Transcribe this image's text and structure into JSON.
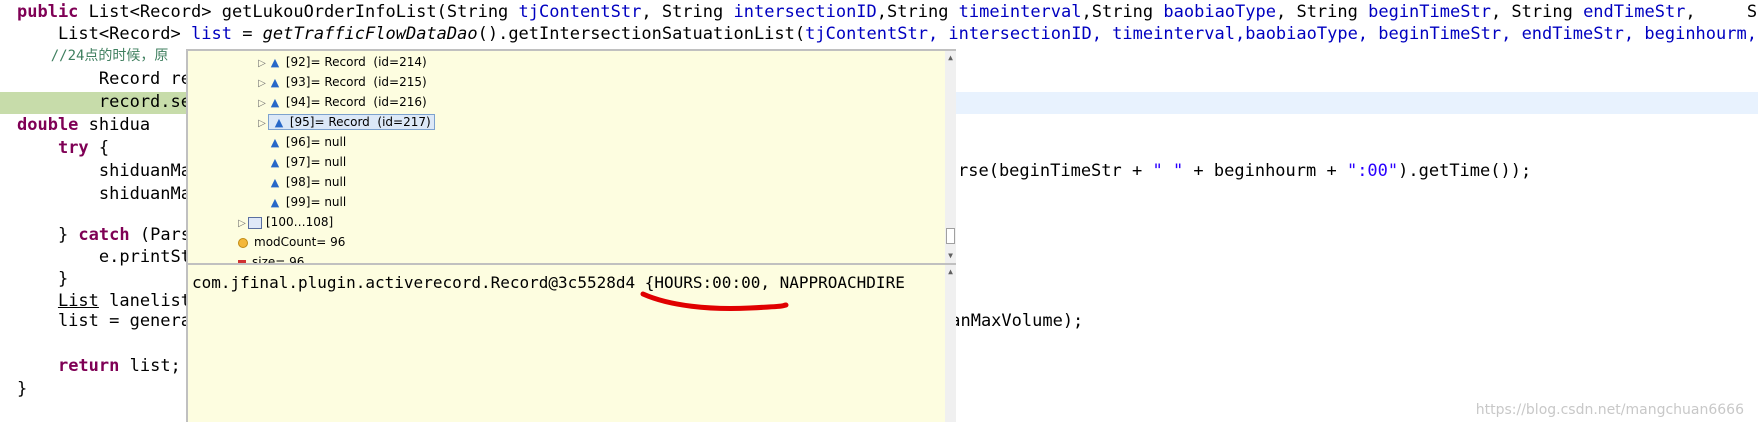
{
  "code": {
    "line1": {
      "kw": "public",
      "text1": " List<Record> getLukouOrderInfoList(String ",
      "p1": "tjContentStr",
      "text2": ", String ",
      "p2": "intersectionID",
      "text3": ",String ",
      "p3": "timeinterval",
      "text4": ",String ",
      "p4": "baobiaoType",
      "text5": ", String ",
      "p5": "beginTimeStr",
      "text6": ", String ",
      "p6": "endTimeStr",
      "text7": ",     String"
    },
    "line2": {
      "text1": "    List<Record> ",
      "var": "list",
      "text2": " = ",
      "call": "getTrafficFlowDataDao",
      "text3": "().getIntersectionSatuationList(",
      "rest": "tjContentStr, intersectionID, timeinterval,baobiaoType, beginTimeStr, endTimeStr, beginhourm, end"
    },
    "line3": {
      "comment": "    //24点的时候，原"
    },
    "line4": {
      "text": "        Record re"
    },
    "line5": {
      "text": "        record.se"
    },
    "line6": {
      "kw": "double",
      "text": " shidua"
    },
    "line7": {
      "kw": "try",
      "text": " {"
    },
    "line8": {
      "left": "        shiduanMa",
      "right": "rse(beginTimeStr + ",
      "s1": "\" \"",
      "mid": " + beginhourm + ",
      "s2": "\":00\"",
      "end": ").getTime());"
    },
    "line9": {
      "left": "        shiduanMa"
    },
    "line10": {
      "text1": "    } ",
      "kw": "catch",
      "text2": " (Pars"
    },
    "line11": {
      "text": "        e.printSt"
    },
    "line12": {
      "text": "    }"
    },
    "line13": {
      "text1": "    ",
      "cls": "List",
      "text2": " lanelist",
      "right": "ianMaxVolume);"
    },
    "line14": {
      "text": "    list = genera"
    },
    "line15": {
      "kw": "return",
      "text": " list;"
    },
    "line16": {
      "text": "}"
    }
  },
  "tree": {
    "items": [
      {
        "label": "[92]= Record  (id=214)",
        "expandable": true,
        "selected": false
      },
      {
        "label": "[93]= Record  (id=215)",
        "expandable": true,
        "selected": false
      },
      {
        "label": "[94]= Record  (id=216)",
        "expandable": true,
        "selected": false
      },
      {
        "label": "[95]= Record  (id=217)",
        "expandable": true,
        "selected": true
      },
      {
        "label": "[96]= null",
        "expandable": false,
        "selected": false
      },
      {
        "label": "[97]= null",
        "expandable": false,
        "selected": false
      },
      {
        "label": "[98]= null",
        "expandable": false,
        "selected": false
      },
      {
        "label": "[99]= null",
        "expandable": false,
        "selected": false
      }
    ],
    "range": "[100…108]",
    "modcount": "modCount= 96",
    "size": "size= 96"
  },
  "detail": {
    "value": "com.jfinal.plugin.activerecord.Record@3c5528d4 {HOURS:00:00, NAPPROACHDIRE"
  },
  "watermark": "https://blog.csdn.net/mangchuan6666",
  "colors": {
    "keyword": "#7f0055",
    "field": "#0000c0",
    "string": "#2a00ff",
    "comment": "#3f7f5f",
    "annotation": "#e00000"
  }
}
